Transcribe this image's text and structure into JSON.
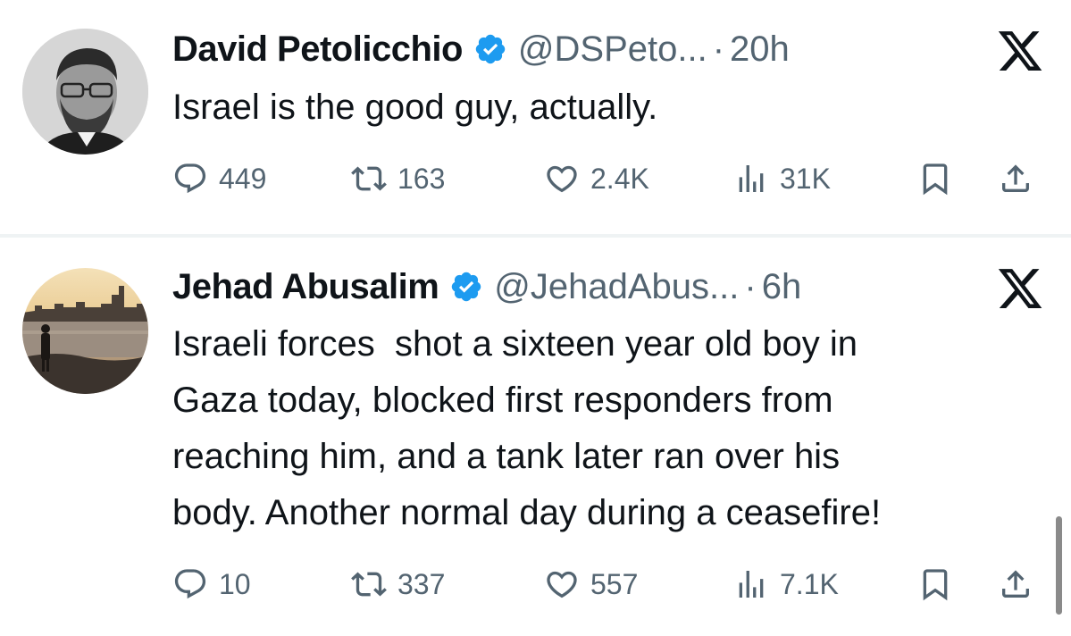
{
  "tweets": [
    {
      "name": "David Petolicchio",
      "handle": "@DSPeto...",
      "separator": "·",
      "time": "20h",
      "text": [
        "Israel is the good guy, actually."
      ],
      "replies": "449",
      "retweets": "163",
      "likes": "2.4K",
      "views": "31K",
      "avatar_icon": "avatar-bearded-man-glasses"
    },
    {
      "name": "Jehad Abusalim",
      "handle": "@JehadAbus...",
      "separator": "·",
      "time": "6h",
      "text": [
        "Israeli forces  shot a sixteen year old boy in",
        "Gaza today, blocked first responders from",
        "reaching him, and a tank later ran over his",
        "body. Another normal day during a ceasefire!"
      ],
      "replies": "10",
      "retweets": "337",
      "likes": "557",
      "views": "7.1K",
      "avatar_icon": "avatar-sunset-silhouette"
    }
  ],
  "colors": {
    "verified": "#1d9bf0",
    "secondary_text": "#536471",
    "primary_text": "#0f1419",
    "divider": "#eff3f4"
  },
  "icons": [
    "verified-badge-icon",
    "x-logo-icon",
    "reply-icon",
    "retweet-icon",
    "like-icon",
    "views-icon",
    "bookmark-icon",
    "share-icon"
  ]
}
